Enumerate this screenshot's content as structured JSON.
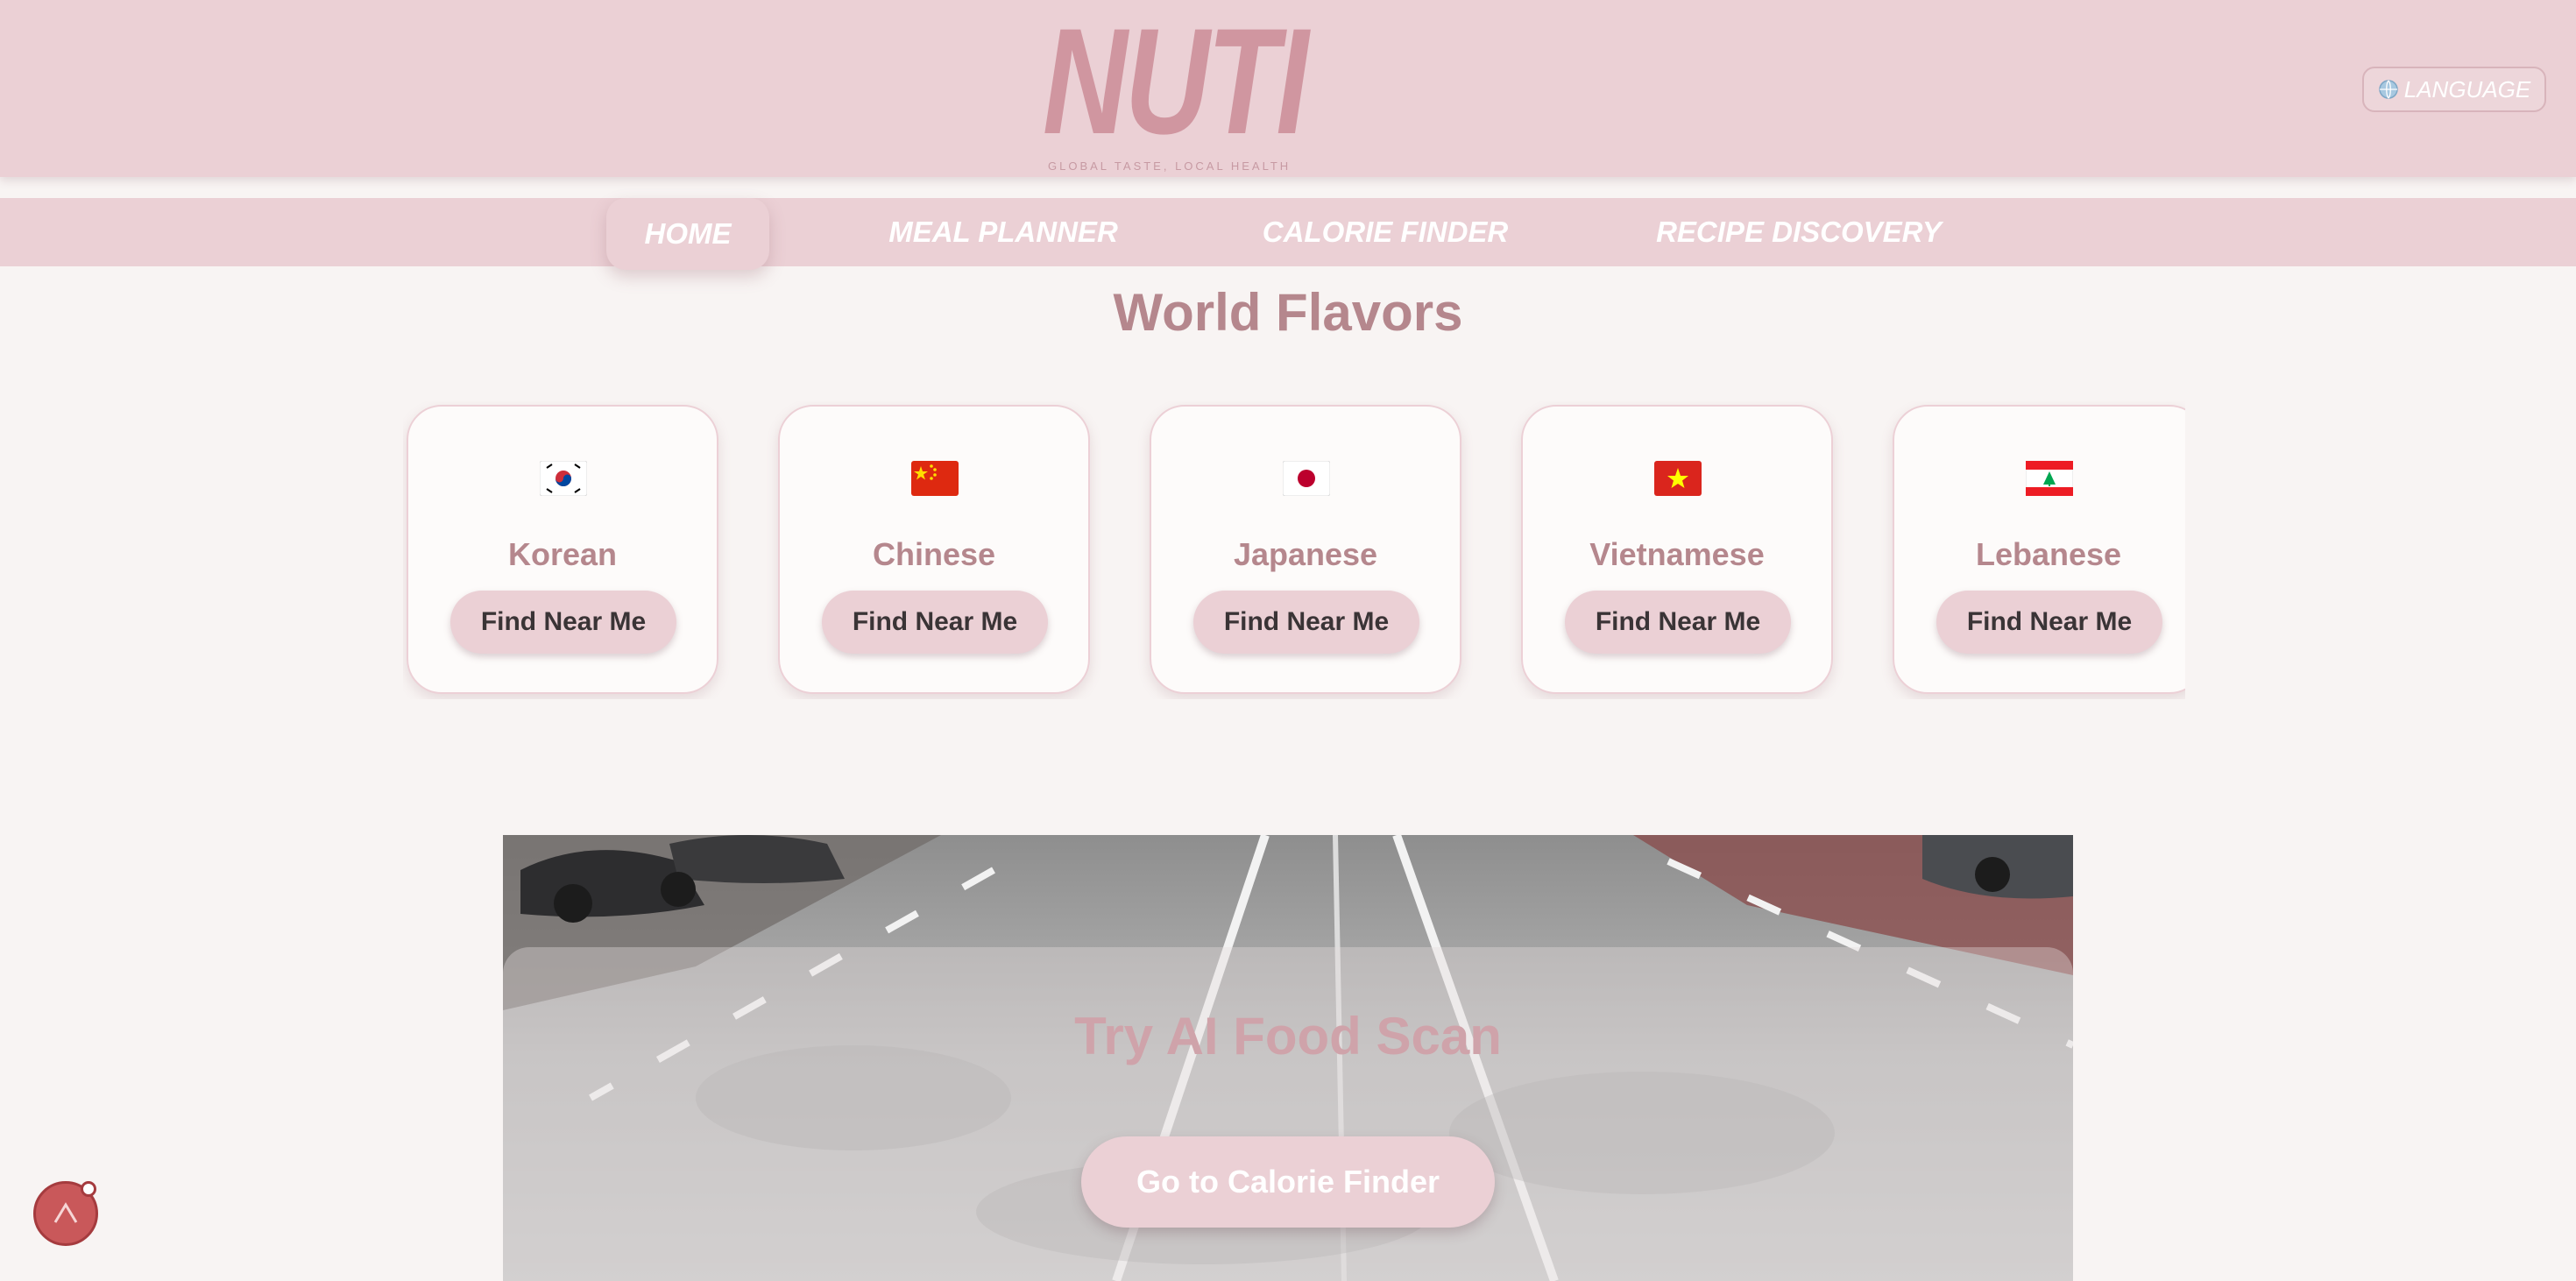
{
  "header": {
    "logo_text": "NUTI",
    "tagline": "GLOBAL TASTE, LOCAL HEALTH",
    "language_label": "LANGUAGE"
  },
  "nav": {
    "items": [
      {
        "label": "HOME",
        "active": true
      },
      {
        "label": "MEAL PLANNER",
        "active": false
      },
      {
        "label": "CALORIE FINDER",
        "active": false
      },
      {
        "label": "RECIPE DISCOVERY",
        "active": false
      }
    ]
  },
  "world_flavors": {
    "title": "World Flavors",
    "cards": [
      {
        "name": "Korean",
        "flag_icon": "korea-flag-icon",
        "button": "Find Near Me"
      },
      {
        "name": "Chinese",
        "flag_icon": "china-flag-icon",
        "button": "Find Near Me"
      },
      {
        "name": "Japanese",
        "flag_icon": "japan-flag-icon",
        "button": "Find Near Me"
      },
      {
        "name": "Vietnamese",
        "flag_icon": "vietnam-flag-icon",
        "button": "Find Near Me"
      },
      {
        "name": "Lebanese",
        "flag_icon": "lebanon-flag-icon",
        "button": "Find Near Me"
      }
    ]
  },
  "ai_scan": {
    "title": "Try AI Food Scan",
    "button": "Go to Calorie Finder"
  },
  "colors": {
    "accent_pink": "#ebd0d5",
    "title_mauve": "#b5878d",
    "background": "#f8f4f3"
  }
}
